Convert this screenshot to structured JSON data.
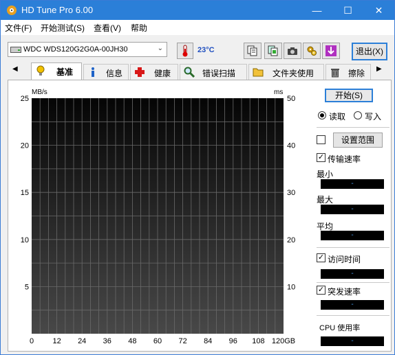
{
  "window": {
    "title": "HD Tune Pro 6.00",
    "minimize": "—",
    "maximize": "☐",
    "close": "✕"
  },
  "menu": [
    "文件(F)",
    "开始测试(S)",
    "查看(V)",
    "帮助"
  ],
  "toolbar": {
    "drive": "WDC WDS120G2G0A-00JH30",
    "temperature": "23°C",
    "exit_label": "退出(X)"
  },
  "tabs": [
    {
      "label": "基准",
      "icon": "lightbulb-icon",
      "active": true
    },
    {
      "label": "信息",
      "icon": "info-icon"
    },
    {
      "label": "健康",
      "icon": "health-cross-icon"
    },
    {
      "label": "错误扫描",
      "icon": "magnifier-icon"
    },
    {
      "label": "文件夹使用",
      "icon": "folder-icon"
    },
    {
      "label": "擦除",
      "icon": "trash-icon"
    }
  ],
  "chart_data": {
    "type": "line",
    "left_unit": "MB/s",
    "right_unit": "ms",
    "y_left": {
      "min": 0,
      "max": 25,
      "ticks": [
        5,
        10,
        15,
        20,
        25
      ]
    },
    "y_right": {
      "min": 0,
      "max": 50,
      "ticks": [
        10,
        20,
        30,
        40,
        50
      ]
    },
    "x": {
      "min": 0,
      "max": 120,
      "ticks": [
        "0",
        "12",
        "24",
        "36",
        "48",
        "60",
        "72",
        "84",
        "96",
        "108",
        "120GB"
      ]
    },
    "grid": true,
    "series": []
  },
  "panel": {
    "start_label": "开始(S)",
    "read_label": "读取",
    "write_label": "写入",
    "range_label": "设置范围",
    "transfer_label": "传输速率",
    "min_label": "最小",
    "max_label": "最大",
    "avg_label": "平均",
    "access_label": "访问时间",
    "burst_label": "突发速率",
    "cpu_label": "CPU 使用率",
    "empty_value": "-"
  },
  "colors": {
    "title_bar": "#2b7fd8",
    "value_text": "#4a9ef0",
    "temperature_text": "#1f4fc0"
  }
}
